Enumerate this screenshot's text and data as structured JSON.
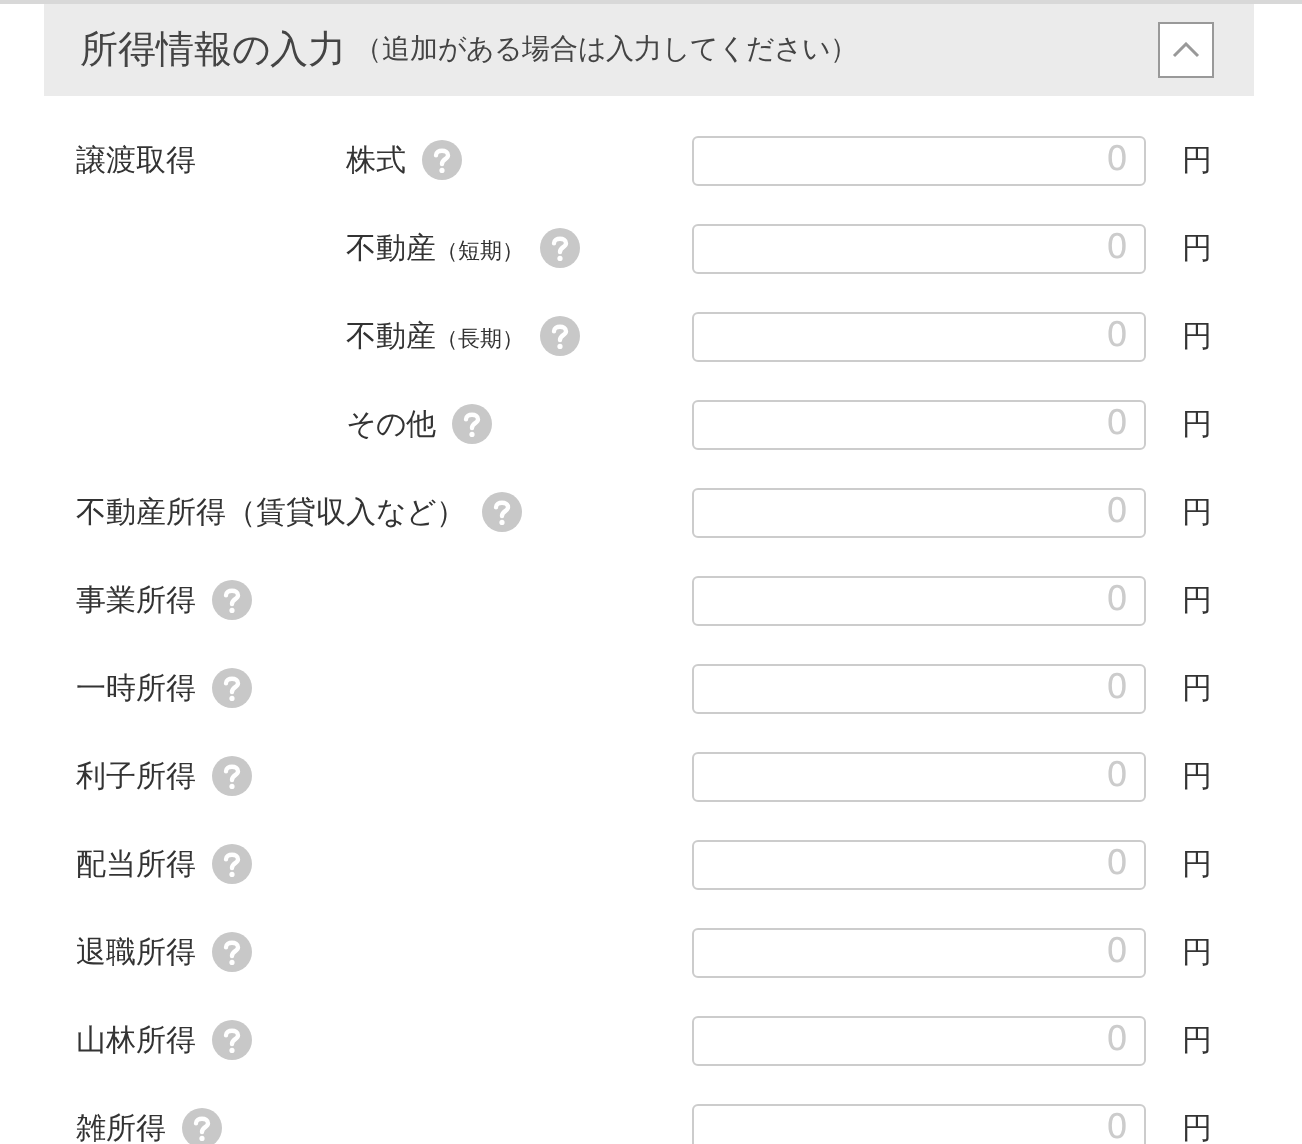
{
  "header": {
    "title": "所得情報の入力",
    "subtitle": "（追加がある場合は入力してください）",
    "expanded": true
  },
  "rows": [
    {
      "group": "譲渡取得",
      "label": "株式",
      "placeholder": "0",
      "unit": "円"
    },
    {
      "label": "不動産",
      "note": "（短期）",
      "placeholder": "0",
      "unit": "円"
    },
    {
      "label": "不動産",
      "note": "（長期）",
      "placeholder": "0",
      "unit": "円"
    },
    {
      "label": "その他",
      "placeholder": "0",
      "unit": "円"
    },
    {
      "group": "不動産所得（賃貸収入など）",
      "placeholder": "0",
      "unit": "円"
    },
    {
      "group": "事業所得",
      "placeholder": "0",
      "unit": "円"
    },
    {
      "group": "一時所得",
      "placeholder": "0",
      "unit": "円"
    },
    {
      "group": "利子所得",
      "placeholder": "0",
      "unit": "円"
    },
    {
      "group": "配当所得",
      "placeholder": "0",
      "unit": "円"
    },
    {
      "group": "退職所得",
      "placeholder": "0",
      "unit": "円"
    },
    {
      "group": "山林所得",
      "placeholder": "0",
      "unit": "円"
    },
    {
      "group": "雑所得",
      "placeholder": "0",
      "unit": "円"
    }
  ]
}
